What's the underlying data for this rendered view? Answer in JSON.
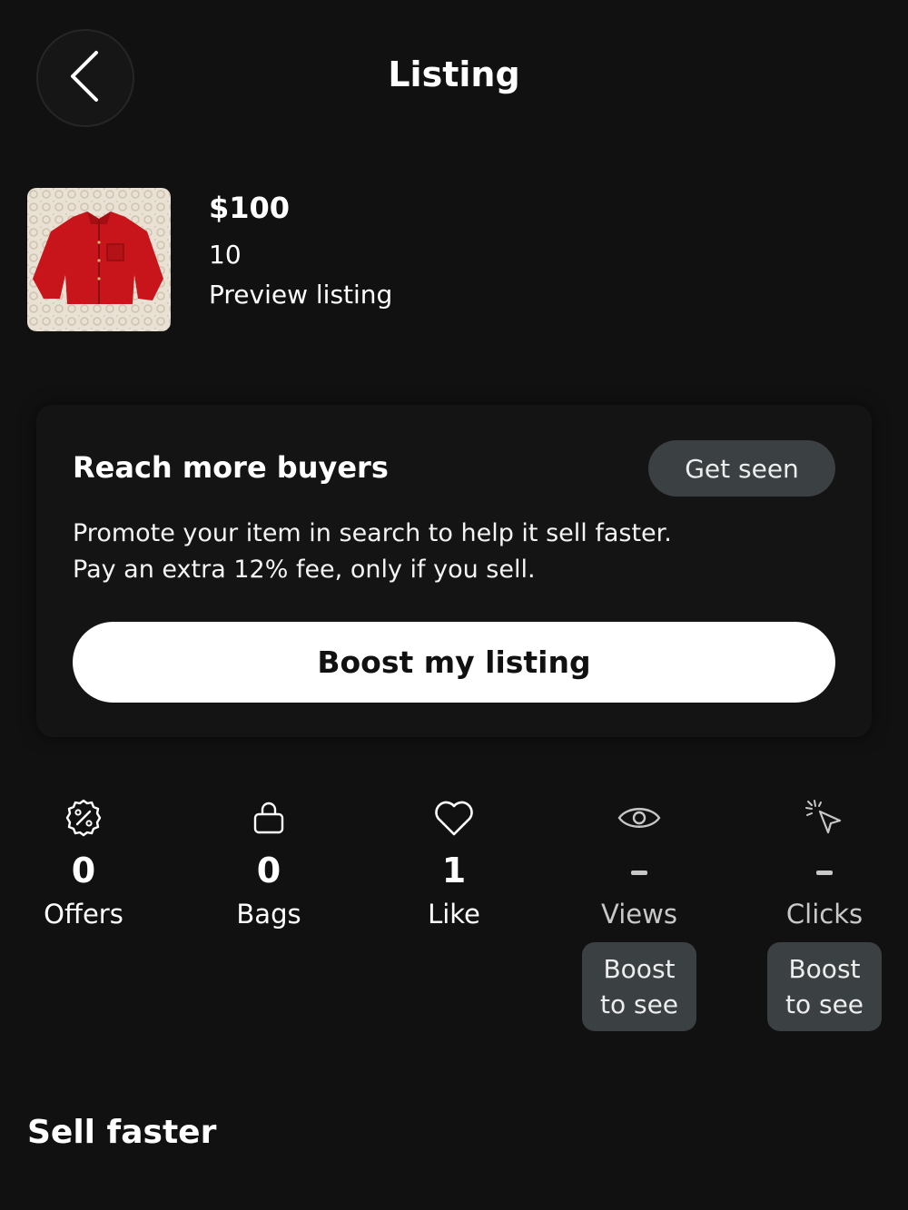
{
  "header": {
    "title": "Listing",
    "back_icon": "chevron-left-icon"
  },
  "listing": {
    "price": "$100",
    "size": "10",
    "preview_label": "Preview listing",
    "thumbnail": "red fleece jacket on lace background"
  },
  "promo": {
    "title": "Reach more buyers",
    "badge": "Get seen",
    "description_line1": "Promote your item in search to help it sell faster.",
    "description_line2": "Pay an extra 12% fee, only if you sell.",
    "button_label": "Boost my listing"
  },
  "stats": [
    {
      "icon": "percent-badge-icon",
      "value": "0",
      "label": "Offers"
    },
    {
      "icon": "bag-icon",
      "value": "0",
      "label": "Bags"
    },
    {
      "icon": "heart-icon",
      "value": "1",
      "label": "Like"
    },
    {
      "icon": "eye-icon",
      "value": "-",
      "label": "Views",
      "tag_line1": "Boost",
      "tag_line2": "to see"
    },
    {
      "icon": "cursor-click-icon",
      "value": "-",
      "label": "Clicks",
      "tag_line1": "Boost",
      "tag_line2": "to see"
    }
  ],
  "sections": {
    "sell_faster_title": "Sell faster"
  },
  "colors": {
    "background": "#111111",
    "card": "#141414",
    "pill": "#3b4043",
    "primary_button": "#ffffff"
  }
}
